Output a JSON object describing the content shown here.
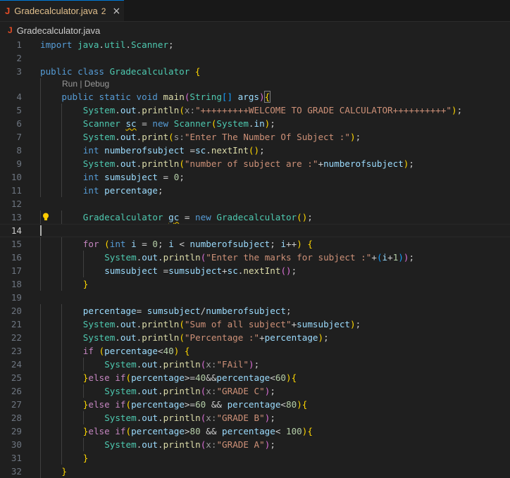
{
  "tab": {
    "icon": "J",
    "filename": "Gradecalculator.java",
    "problems": "2",
    "close": "×"
  },
  "breadcrumb": {
    "icon": "J",
    "filename": "Gradecalculator.java"
  },
  "codelens": "Run | Debug",
  "line_numbers": [
    "1",
    "2",
    "3",
    "4",
    "5",
    "6",
    "7",
    "8",
    "9",
    "10",
    "11",
    "12",
    "13",
    "14",
    "15",
    "16",
    "17",
    "18",
    "19",
    "20",
    "21",
    "22",
    "23",
    "24",
    "25",
    "26",
    "27",
    "28",
    "29",
    "30",
    "31",
    "32"
  ],
  "lines": [
    [
      [
        "k",
        "import "
      ],
      [
        "t",
        "java"
      ],
      [
        "",
        "."
      ],
      [
        "t",
        "util"
      ],
      [
        "",
        "."
      ],
      [
        "t",
        "Scanner"
      ],
      [
        "",
        ";"
      ]
    ],
    [],
    [
      [
        "k",
        "public "
      ],
      [
        "k",
        "class "
      ],
      [
        "t",
        "Gradecalculator "
      ],
      [
        "b1",
        "{"
      ]
    ],
    [
      [
        "k",
        "public "
      ],
      [
        "k",
        "static "
      ],
      [
        "k",
        "void "
      ],
      [
        "f",
        "main"
      ],
      [
        "b2",
        "("
      ],
      [
        "t",
        "String"
      ],
      [
        "b3",
        "[]"
      ],
      [
        "v",
        " args"
      ],
      [
        "b2",
        ")"
      ],
      [
        "",
        ""
      ],
      [
        "b1bm",
        "{"
      ]
    ],
    [
      [
        "t",
        "System"
      ],
      [
        "",
        "."
      ],
      [
        "v",
        "out"
      ],
      [
        "",
        "."
      ],
      [
        "f",
        "println"
      ],
      [
        "b1",
        "("
      ],
      [
        "hint",
        "x:"
      ],
      [
        "s",
        "\"+++++++++WELCOME TO GRADE CALCULATOR++++++++++\""
      ],
      [
        "b1",
        ")"
      ],
      [
        "",
        ";"
      ]
    ],
    [
      [
        "t",
        "Scanner "
      ],
      [
        "vw",
        "sc"
      ],
      [
        "",
        " = "
      ],
      [
        "k",
        "new "
      ],
      [
        "t",
        "Scanner"
      ],
      [
        "b1",
        "("
      ],
      [
        "t",
        "System"
      ],
      [
        "",
        "."
      ],
      [
        "v",
        "in"
      ],
      [
        "b1",
        ")"
      ],
      [
        "",
        ";"
      ]
    ],
    [
      [
        "t",
        "System"
      ],
      [
        "",
        "."
      ],
      [
        "v",
        "out"
      ],
      [
        "",
        "."
      ],
      [
        "f",
        "print"
      ],
      [
        "b1",
        "("
      ],
      [
        "hint",
        "s:"
      ],
      [
        "s",
        "\"Enter The Number Of Subject :\""
      ],
      [
        "b1",
        ")"
      ],
      [
        "",
        ";"
      ]
    ],
    [
      [
        "k",
        "int "
      ],
      [
        "v",
        "numberofsubject "
      ],
      [
        "",
        "="
      ],
      [
        "v",
        "sc"
      ],
      [
        "",
        "."
      ],
      [
        "f",
        "nextInt"
      ],
      [
        "b1",
        "()"
      ],
      [
        "",
        ";"
      ]
    ],
    [
      [
        "t",
        "System"
      ],
      [
        "",
        "."
      ],
      [
        "v",
        "out"
      ],
      [
        "",
        "."
      ],
      [
        "f",
        "println"
      ],
      [
        "b1",
        "("
      ],
      [
        "s",
        "\"number of subject are :\""
      ],
      [
        "",
        "+"
      ],
      [
        "v",
        "numberofsubject"
      ],
      [
        "b1",
        ")"
      ],
      [
        "",
        ";"
      ]
    ],
    [
      [
        "k",
        "int "
      ],
      [
        "v",
        "sumsubject"
      ],
      [
        "",
        " = "
      ],
      [
        "n",
        "0"
      ],
      [
        "",
        ";"
      ]
    ],
    [
      [
        "k",
        "int "
      ],
      [
        "v",
        "percentage"
      ],
      [
        "",
        ";"
      ]
    ],
    [],
    [
      [
        "t",
        "Gradecalculator "
      ],
      [
        "vw",
        "gc"
      ],
      [
        "",
        " = "
      ],
      [
        "k",
        "new "
      ],
      [
        "t",
        "Gradecalculator"
      ],
      [
        "b1",
        "()"
      ],
      [
        "",
        ";"
      ]
    ],
    [],
    [
      [
        "kc",
        "for "
      ],
      [
        "b1",
        "("
      ],
      [
        "k",
        "int "
      ],
      [
        "v",
        "i"
      ],
      [
        "",
        " = "
      ],
      [
        "n",
        "0"
      ],
      [
        "",
        "; "
      ],
      [
        "v",
        "i"
      ],
      [
        "",
        " < "
      ],
      [
        "v",
        "numberofsubject"
      ],
      [
        "",
        "; "
      ],
      [
        "v",
        "i"
      ],
      [
        "",
        "++"
      ],
      [
        "b1",
        ")"
      ],
      [
        "",
        " "
      ],
      [
        "b1",
        "{"
      ]
    ],
    [
      [
        "t",
        "System"
      ],
      [
        "",
        "."
      ],
      [
        "v",
        "out"
      ],
      [
        "",
        "."
      ],
      [
        "f",
        "println"
      ],
      [
        "b2",
        "("
      ],
      [
        "s",
        "\"Enter the marks for subject :\""
      ],
      [
        "",
        "+"
      ],
      [
        "b3",
        "("
      ],
      [
        "v",
        "i"
      ],
      [
        "",
        "+"
      ],
      [
        "n",
        "1"
      ],
      [
        "b3",
        ")"
      ],
      [
        "b2",
        ")"
      ],
      [
        "",
        ";"
      ]
    ],
    [
      [
        "v",
        "sumsubject "
      ],
      [
        "",
        "="
      ],
      [
        "v",
        "sumsubject"
      ],
      [
        "",
        "+"
      ],
      [
        "v",
        "sc"
      ],
      [
        "",
        "."
      ],
      [
        "f",
        "nextInt"
      ],
      [
        "b2",
        "()"
      ],
      [
        "",
        ";"
      ]
    ],
    [
      [
        "b1",
        "}"
      ]
    ],
    [],
    [
      [
        "v",
        "percentage"
      ],
      [
        "",
        "= "
      ],
      [
        "v",
        "sumsubject"
      ],
      [
        "",
        "/"
      ],
      [
        "v",
        "numberofsubject"
      ],
      [
        "",
        ";"
      ]
    ],
    [
      [
        "t",
        "System"
      ],
      [
        "",
        "."
      ],
      [
        "v",
        "out"
      ],
      [
        "",
        "."
      ],
      [
        "f",
        "println"
      ],
      [
        "b1",
        "("
      ],
      [
        "s",
        "\"Sum of all subject\""
      ],
      [
        "",
        "+"
      ],
      [
        "v",
        "sumsubject"
      ],
      [
        "b1",
        ")"
      ],
      [
        "",
        ";"
      ]
    ],
    [
      [
        "t",
        "System"
      ],
      [
        "",
        "."
      ],
      [
        "v",
        "out"
      ],
      [
        "",
        "."
      ],
      [
        "f",
        "println"
      ],
      [
        "b1",
        "("
      ],
      [
        "s",
        "\"Percentage :\""
      ],
      [
        "",
        "+"
      ],
      [
        "v",
        "percentage"
      ],
      [
        "b1",
        ")"
      ],
      [
        "",
        ";"
      ]
    ],
    [
      [
        "kc",
        "if "
      ],
      [
        "b1",
        "("
      ],
      [
        "v",
        "percentage"
      ],
      [
        "",
        "<"
      ],
      [
        "n",
        "40"
      ],
      [
        "b1",
        ")"
      ],
      [
        "",
        " "
      ],
      [
        "b1",
        "{"
      ]
    ],
    [
      [
        "t",
        "System"
      ],
      [
        "",
        "."
      ],
      [
        "v",
        "out"
      ],
      [
        "",
        "."
      ],
      [
        "f",
        "println"
      ],
      [
        "b2",
        "("
      ],
      [
        "hint",
        "x:"
      ],
      [
        "s",
        "\"FAil\""
      ],
      [
        "b2",
        ")"
      ],
      [
        "",
        ";"
      ]
    ],
    [
      [
        "b1",
        "}"
      ],
      [
        "kc",
        "else "
      ],
      [
        "kc",
        "if"
      ],
      [
        "b1",
        "("
      ],
      [
        "v",
        "percentage"
      ],
      [
        "",
        ">="
      ],
      [
        "n",
        "40"
      ],
      [
        "",
        "&&"
      ],
      [
        "v",
        "percentage"
      ],
      [
        "",
        "<"
      ],
      [
        "n",
        "60"
      ],
      [
        "b1",
        ")"
      ],
      [
        "b1",
        "{"
      ]
    ],
    [
      [
        "t",
        "System"
      ],
      [
        "",
        "."
      ],
      [
        "v",
        "out"
      ],
      [
        "",
        "."
      ],
      [
        "f",
        "println"
      ],
      [
        "b2",
        "("
      ],
      [
        "hint",
        "x:"
      ],
      [
        "s",
        "\"GRADE C\""
      ],
      [
        "b2",
        ")"
      ],
      [
        "",
        ";"
      ]
    ],
    [
      [
        "b1",
        "}"
      ],
      [
        "kc",
        "else "
      ],
      [
        "kc",
        "if"
      ],
      [
        "b1",
        "("
      ],
      [
        "v",
        "percentage"
      ],
      [
        "",
        ">="
      ],
      [
        "n",
        "60"
      ],
      [
        "",
        " && "
      ],
      [
        "v",
        "percentage"
      ],
      [
        "",
        "<"
      ],
      [
        "n",
        "80"
      ],
      [
        "b1",
        ")"
      ],
      [
        "b1",
        "{"
      ]
    ],
    [
      [
        "t",
        "System"
      ],
      [
        "",
        "."
      ],
      [
        "v",
        "out"
      ],
      [
        "",
        "."
      ],
      [
        "f",
        "println"
      ],
      [
        "b2",
        "("
      ],
      [
        "hint",
        "x:"
      ],
      [
        "s",
        "\"GRADE B\""
      ],
      [
        "b2",
        ")"
      ],
      [
        "",
        ";"
      ]
    ],
    [
      [
        "b1",
        "}"
      ],
      [
        "kc",
        "else "
      ],
      [
        "kc",
        "if"
      ],
      [
        "b1",
        "("
      ],
      [
        "v",
        "percentage"
      ],
      [
        "",
        ">"
      ],
      [
        "n",
        "80"
      ],
      [
        "",
        " && "
      ],
      [
        "v",
        "percentage"
      ],
      [
        "",
        "< "
      ],
      [
        "n",
        "100"
      ],
      [
        "b1",
        ")"
      ],
      [
        "b1",
        "{"
      ]
    ],
    [
      [
        "t",
        "System"
      ],
      [
        "",
        "."
      ],
      [
        "v",
        "out"
      ],
      [
        "",
        "."
      ],
      [
        "f",
        "println"
      ],
      [
        "b2",
        "("
      ],
      [
        "hint",
        "x:"
      ],
      [
        "s",
        "\"GRADE A\""
      ],
      [
        "b2",
        ")"
      ],
      [
        "",
        ";"
      ]
    ],
    [
      [
        "b1",
        "}"
      ]
    ],
    [
      [
        "b1",
        "}"
      ]
    ]
  ],
  "colors": {
    "background": "#1f1f1f",
    "accent": "#0078d4",
    "modified_tab": "#e2c08d",
    "java_icon": "#e34c26"
  }
}
